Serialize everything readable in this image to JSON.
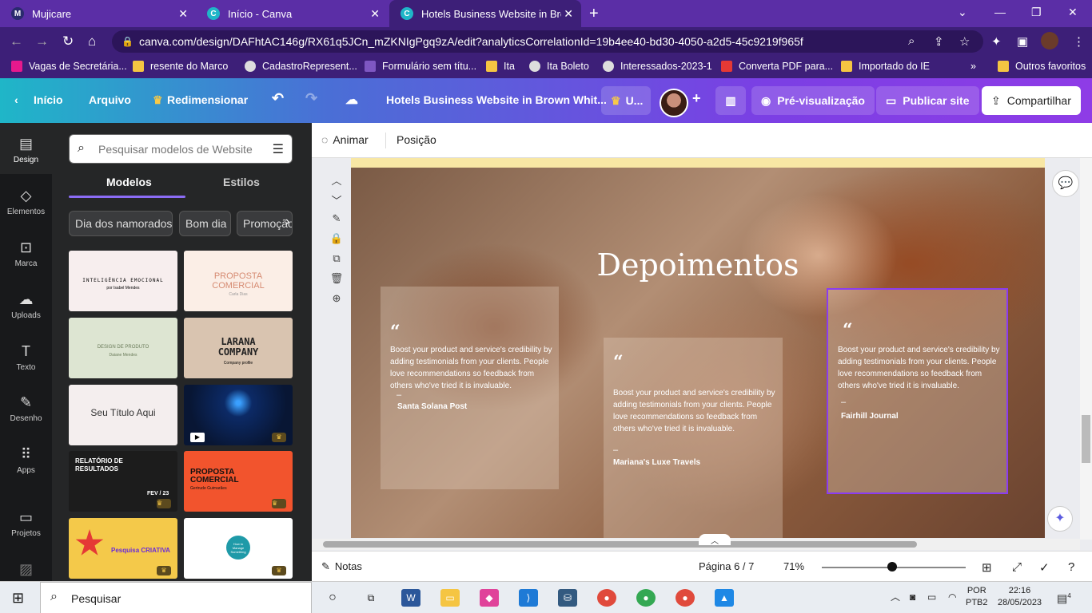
{
  "browser": {
    "tabs": [
      {
        "title": "Mujicare",
        "active": false
      },
      {
        "title": "Início - Canva",
        "active": false
      },
      {
        "title": "Hotels Business Website in Brown",
        "active": true
      }
    ],
    "url": "canva.com/design/DAFhtAC146g/RX61q5JCn_mZKNIgPgq9zA/edit?analyticsCorrelationId=19b4ee40-bd30-4050-a2d5-45c9219f965f",
    "bookmarks": [
      "Vagas de Secretária...",
      "resente do Marco",
      "CadastroRepresent...",
      "Formulário sem títu...",
      "Ita",
      "Ita Boleto",
      "Interessados-2023-1",
      "Converta PDF para...",
      "Importado do IE",
      "Outros favoritos"
    ]
  },
  "canva_header": {
    "back_label": "Início",
    "file_label": "Arquivo",
    "resize_label": "Redimensionar",
    "doc_title": "Hotels Business Website in Brown Whit...",
    "upgrade_label": "U...",
    "preview_label": "Pré-visualização",
    "publish_label": "Publicar site",
    "share_label": "Compartilhar"
  },
  "rail": [
    "Design",
    "Elementos",
    "Marca",
    "Uploads",
    "Texto",
    "Desenho",
    "Apps",
    "Projetos"
  ],
  "panel": {
    "search_placeholder": "Pesquisar modelos de Website",
    "tabs": [
      "Modelos",
      "Estilos"
    ],
    "chips": [
      "Dia dos namorados",
      "Bom dia",
      "Promoção"
    ],
    "templates": [
      {
        "text": "INTELIGÊNCIA EMOCIONAL",
        "sub": "por Isabel Mendes"
      },
      {
        "text": "PROPOSTA COMERCIAL",
        "sub": "Carla Dias"
      },
      {
        "text": "DESIGN DE PRODUTO",
        "sub": "Daiane Mendes"
      },
      {
        "text": "LARANA COMPANY",
        "sub": "Company profile"
      },
      {
        "text": "Seu Título Aqui",
        "sub": ""
      },
      {
        "text": "",
        "sub": ""
      },
      {
        "text": "RELATÓRIO DE RESULTADOS",
        "sub": "FEV / 23"
      },
      {
        "text": "PROPOSTA COMERCIAL",
        "sub": "Gertrude Guimarães"
      },
      {
        "text": "Pesquisa CRIATIVA",
        "sub": ""
      },
      {
        "text": "How to Manage Something",
        "sub": ""
      }
    ]
  },
  "editor_toolbar": {
    "animate": "Animar",
    "position": "Posição"
  },
  "slide": {
    "title": "Depoimentos",
    "cards": [
      {
        "quote": "Boost your product and service's credibility by adding testimonials from your clients. People love recommendations so feedback from others who've tried it is invaluable.",
        "dash": "–",
        "source": "Santa Solana Post"
      },
      {
        "quote": "Boost your product and service's credibility by adding testimonials from your clients. People love recommendations so feedback from others who've tried it is invaluable.",
        "dash": "–",
        "source": "Mariana's Luxe Travels"
      },
      {
        "quote": "Boost your product and service's credibility by adding testimonials from your clients. People love recommendations so feedback from others who've tried it is invaluable.",
        "dash": "–",
        "source": "Fairhill Journal"
      }
    ]
  },
  "footer": {
    "notes": "Notas",
    "page": "Página 6 / 7",
    "zoom": "71%",
    "zoom_fraction": 0.49
  },
  "taskbar": {
    "search_placeholder": "Pesquisar",
    "lang": "POR",
    "layout": "PTB2",
    "time": "22:16",
    "date": "28/05/2023",
    "notifications": "4"
  },
  "colors": {
    "tabbar": "#5b2ea6",
    "accent": "#8b3cf0",
    "canva_gradient_start": "#1fb6c8",
    "canva_gradient_end": "#8e3ce6"
  }
}
